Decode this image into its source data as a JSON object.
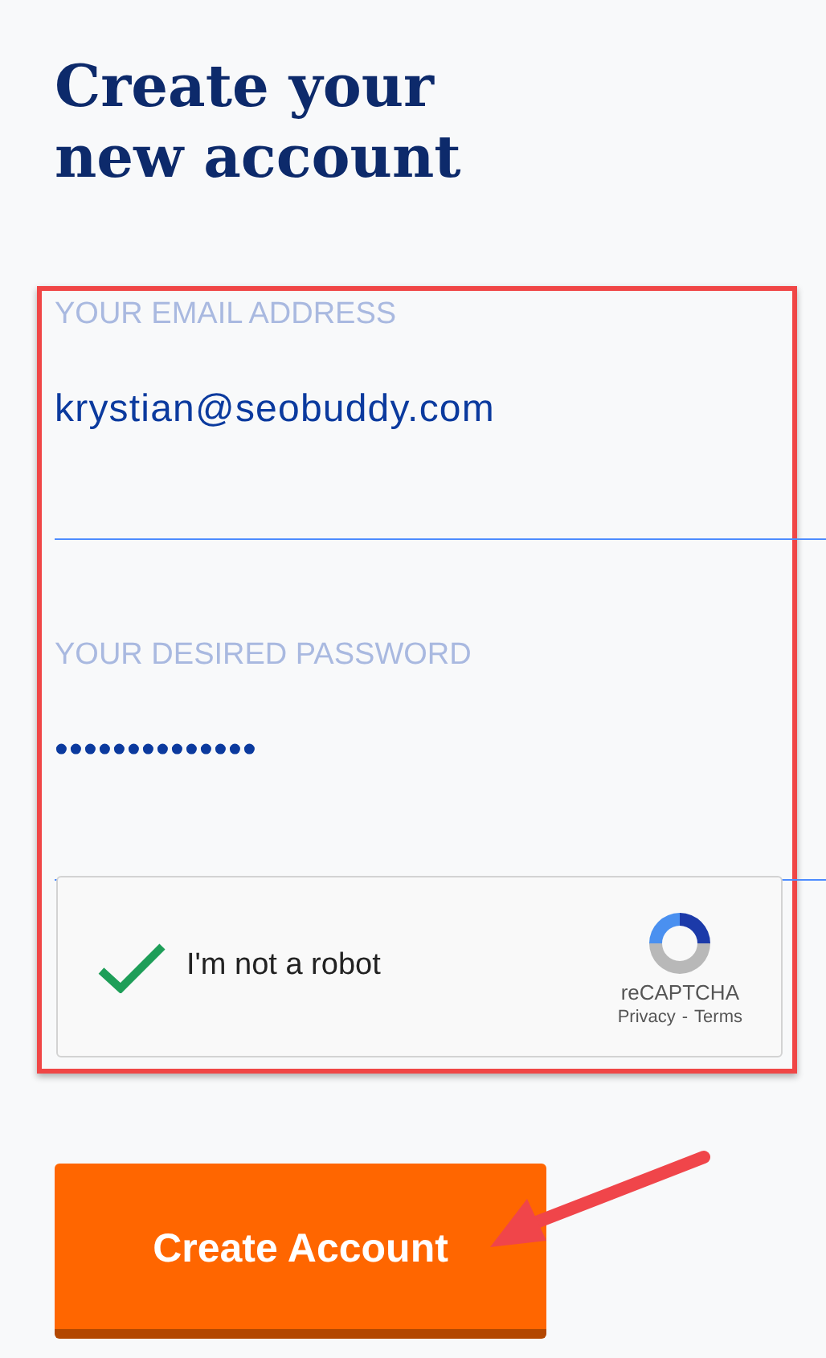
{
  "title": "Create your new account",
  "fields": [
    {
      "label": "YOUR EMAIL ADDRESS",
      "value": "krystian@seobuddy.com"
    },
    {
      "label": "YOUR DESIRED PASSWORD",
      "value": "••••••••••••••"
    }
  ],
  "captcha": {
    "label": "I'm not a robot",
    "checked": true,
    "brand": "reCAPTCHA",
    "privacy": "Privacy",
    "separator": "-",
    "terms": "Terms"
  },
  "submit_button": "Create Account"
}
